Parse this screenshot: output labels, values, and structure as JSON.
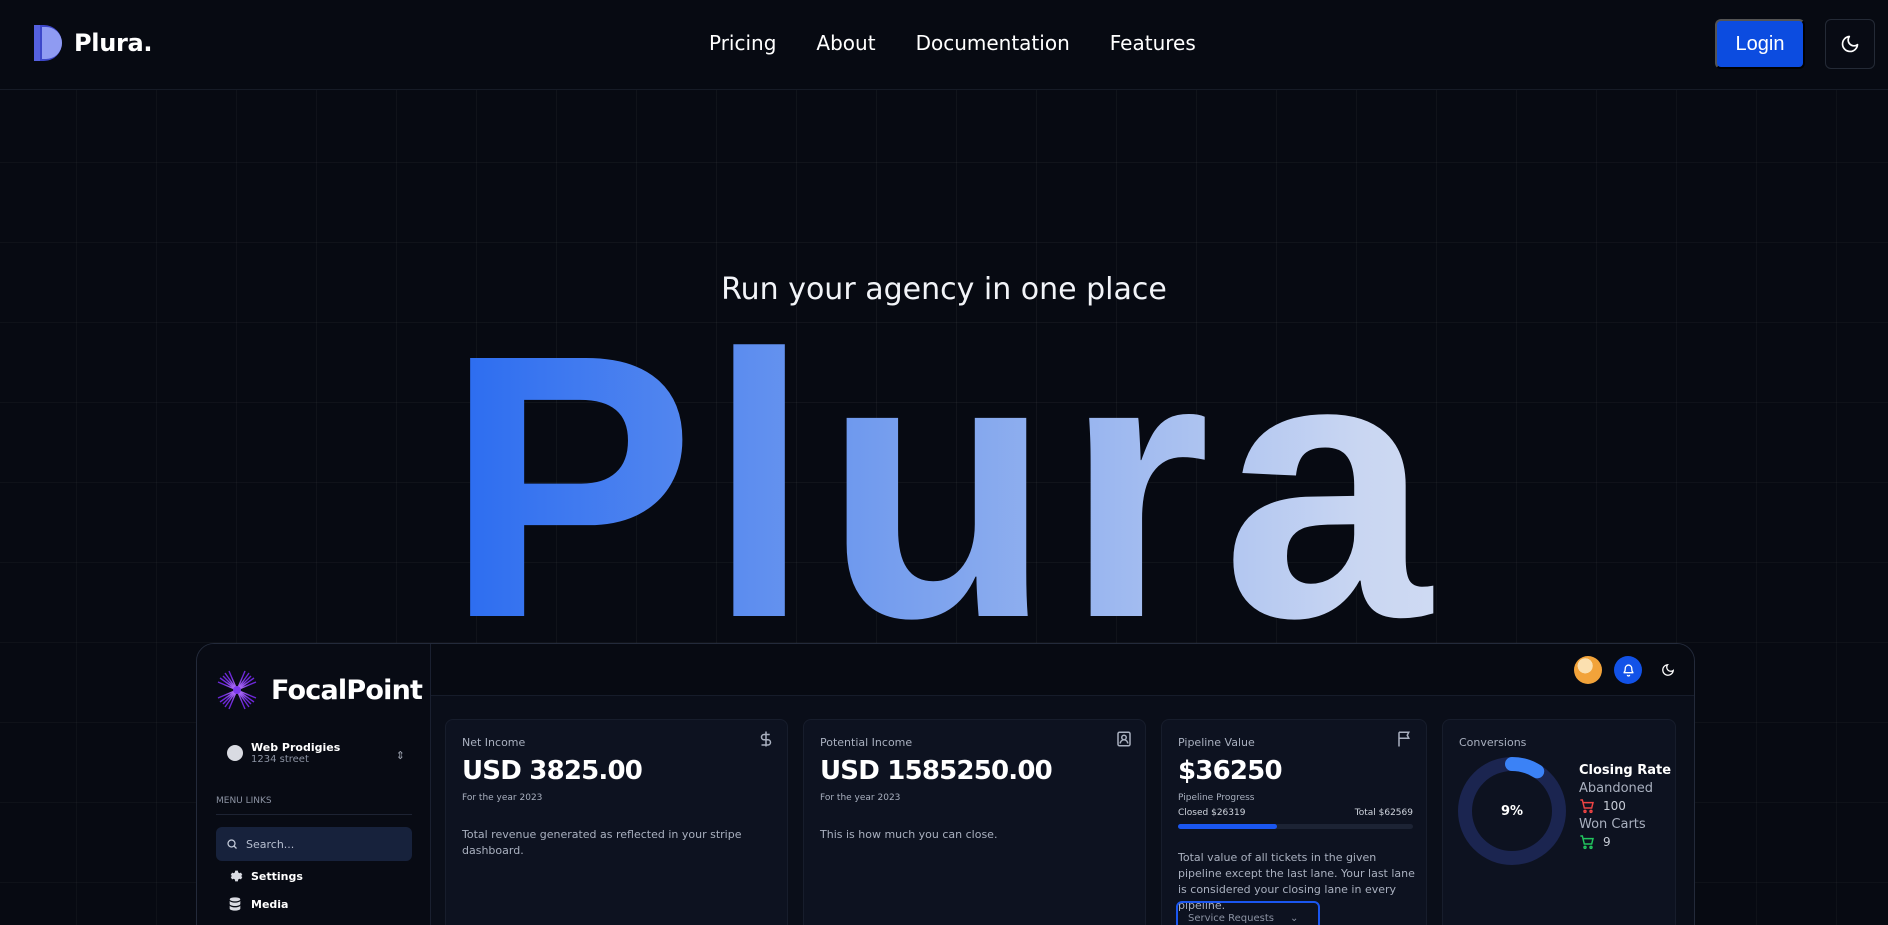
{
  "nav": {
    "logo_text": "Plura.",
    "links": [
      "Pricing",
      "About",
      "Documentation",
      "Features"
    ],
    "login_label": "Login"
  },
  "hero": {
    "tagline": "Run your agency in one place",
    "title": "Plura"
  },
  "colors": {
    "background": "#070a12",
    "accent": "#0c4ce0",
    "gradient_start": "#0b4de6",
    "gradient_end": "#f0f2f8"
  },
  "dashboard": {
    "brand": "FocalPoint",
    "account": {
      "name": "Web Prodigies",
      "address": "1234 street"
    },
    "menu_label": "MENU LINKS",
    "search_placeholder": "Search...",
    "menu_items": [
      {
        "label": "Settings",
        "icon": "gear-icon"
      },
      {
        "label": "Media",
        "icon": "database-icon"
      }
    ],
    "cards": {
      "net_income": {
        "label": "Net Income",
        "value": "USD 3825.00",
        "sub": "For the year 2023",
        "desc": "Total revenue generated as reflected in your stripe dashboard.",
        "icon": "dollar-icon"
      },
      "potential_income": {
        "label": "Potential Income",
        "value": "USD 1585250.00",
        "sub": "For the year 2023",
        "desc": "This is how much you can close.",
        "icon": "contact-icon"
      },
      "pipeline": {
        "label": "Pipeline Value",
        "value": "$36250",
        "sub": "Pipeline Progress",
        "closed": "Closed $26319",
        "total": "Total $62569",
        "progress": 0.42,
        "desc": "Total value of all tickets in the given pipeline except the last lane. Your last lane is considered your closing lane in every pipeline.",
        "select_value": "Service Requests",
        "icon": "flag-icon"
      },
      "conversions": {
        "label": "Conversions",
        "percent_label": "9%",
        "percent": 9,
        "closing_rate_title": "Closing Rate",
        "abandoned_label": "Abandoned",
        "abandoned_value": "100",
        "won_label": "Won Carts",
        "won_value": "9"
      }
    }
  }
}
